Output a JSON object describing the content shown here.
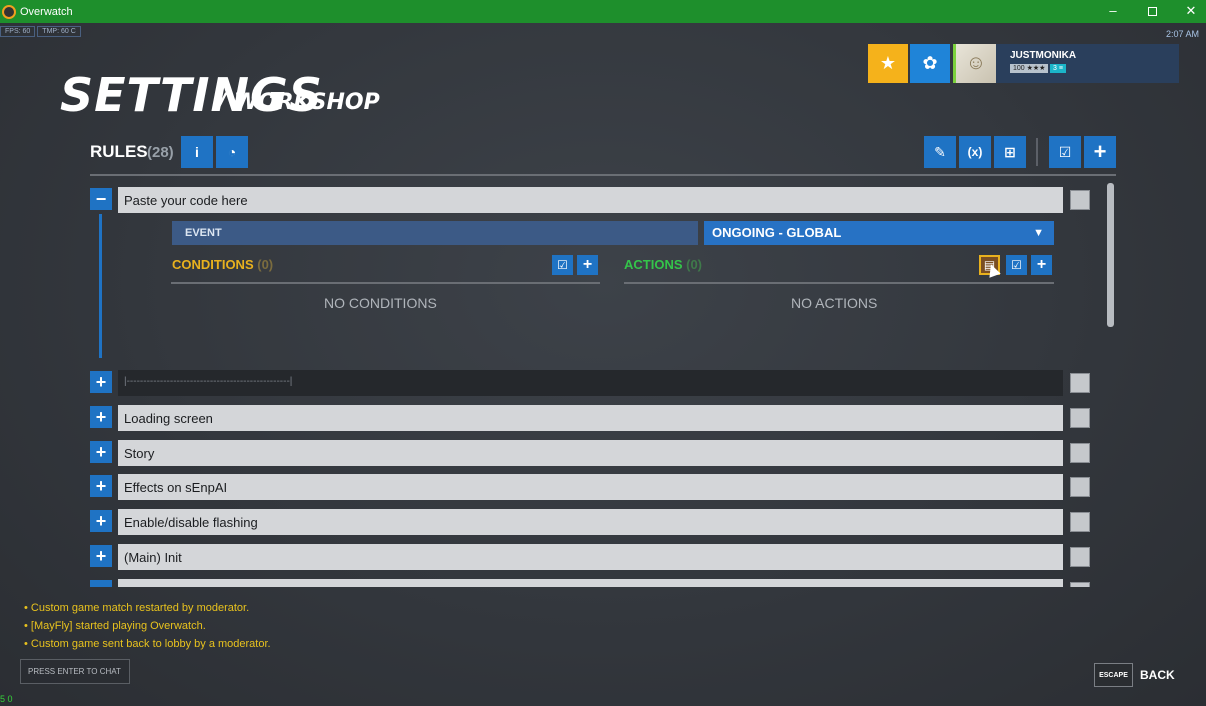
{
  "window": {
    "title": "Overwatch",
    "minimize_glyph": "–",
    "close_glyph": "✕"
  },
  "perf": {
    "fps": "FPS: 60",
    "tmp": "TMP: 60 C"
  },
  "clock": "2:07 AM",
  "header": {
    "title": "SETTINGS",
    "subtitle": "/ WORKSHOP"
  },
  "profile": {
    "name": "JUSTMONIKA",
    "level": "100 ★★★",
    "endorsement": "3 ≡",
    "find_icon": "find-group-icon",
    "friends_icon": "social-icon"
  },
  "rules": {
    "label": "RULES",
    "count": "(28)",
    "icons": {
      "info": "i",
      "speed": "◔",
      "edit": "✎",
      "vars": "(x)",
      "tree": "⊞",
      "check": "☑",
      "add": "+"
    }
  },
  "expanded_rule": {
    "name": "Paste your code here",
    "toggle": "−",
    "event_label": "EVENT",
    "event_value": "ONGOING - GLOBAL",
    "conditions_label": "CONDITIONS",
    "conditions_count": "(0)",
    "actions_label": "ACTIONS",
    "actions_count": "(0)",
    "no_conditions": "NO CONDITIONS",
    "no_actions": "NO ACTIONS"
  },
  "rule_list": [
    {
      "name": "|-------------------------------------------------|",
      "toggle": "+"
    },
    {
      "name": "Loading screen",
      "toggle": "+"
    },
    {
      "name": "Story",
      "toggle": "+"
    },
    {
      "name": "Effects on sEnpAI",
      "toggle": "+"
    },
    {
      "name": "Enable/disable flashing",
      "toggle": "+"
    },
    {
      "name": "(Main) Init",
      "toggle": "+"
    }
  ],
  "chat": {
    "messages": [
      "• Custom game match restarted by moderator.",
      "• [MayFly] started playing Overwatch.",
      "• Custom game sent back to lobby by a moderator."
    ],
    "input_placeholder": "PRESS ENTER TO CHAT"
  },
  "footer": {
    "escape_key": "ESCAPE",
    "back_label": "BACK",
    "corner": "5 0"
  },
  "colors": {
    "titlebar": "#1e8f2c",
    "accent_blue": "#1f73c4",
    "conditions": "#e8b11e",
    "actions": "#34c44a"
  }
}
